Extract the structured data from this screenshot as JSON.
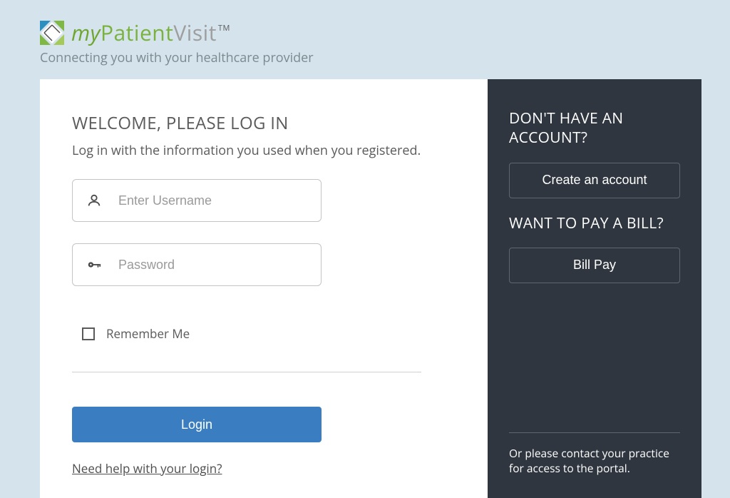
{
  "brand": {
    "my": "my",
    "patient": "Patient",
    "visit": "Visit",
    "tm": "TM",
    "tagline": "Connecting you with your healthcare provider"
  },
  "login": {
    "title": "WELCOME, PLEASE LOG IN",
    "subtitle": "Log in with the information you used when you registered.",
    "username_placeholder": "Enter Username",
    "password_placeholder": "Password",
    "remember_label": "Remember Me",
    "login_button": "Login",
    "help_link": "Need help with your login?"
  },
  "sidebar": {
    "no_account_title": "DON'T HAVE AN ACCOUNT?",
    "create_account_button": "Create an account",
    "pay_bill_title": "WANT TO PAY A BILL?",
    "bill_pay_button": "Bill Pay",
    "contact_note": "Or please contact your practice for access to the portal."
  }
}
